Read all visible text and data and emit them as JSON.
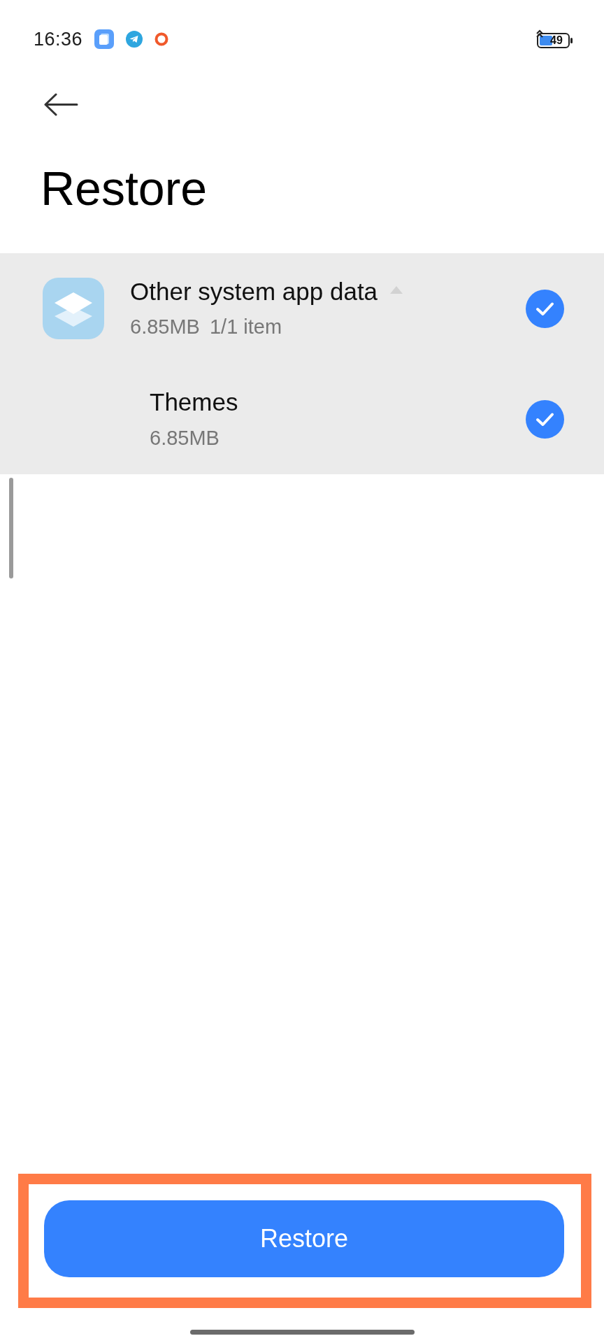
{
  "status_bar": {
    "time": "16:36",
    "battery": "49"
  },
  "header": {
    "title": "Restore"
  },
  "groups": [
    {
      "name": "Other system app data",
      "size": "6.85MB",
      "count": "1/1 item",
      "expanded": true,
      "checked": true,
      "children": [
        {
          "name": "Themes",
          "size": "6.85MB",
          "checked": true
        }
      ]
    }
  ],
  "restore_button": {
    "label": "Restore",
    "highlighted": true
  }
}
